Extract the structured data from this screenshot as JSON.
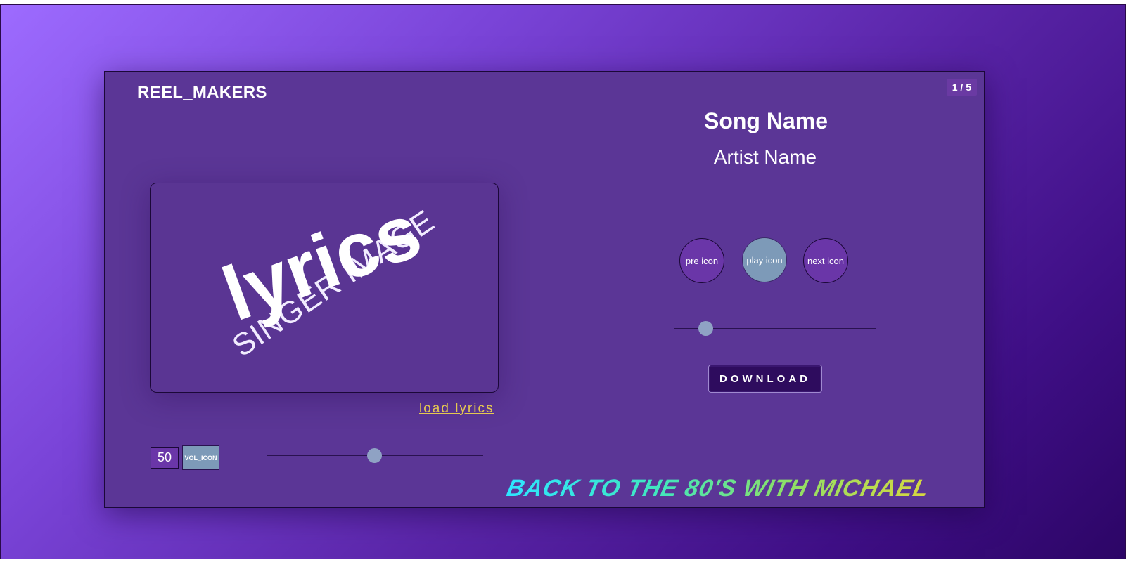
{
  "brand": "REEL_MAKERS",
  "counter": "1 / 5",
  "song": {
    "name": "Song Name",
    "artist": "Artist Name"
  },
  "art": {
    "singer_image_text": "SINGER IMAGE",
    "lyrics_text": "lyrics"
  },
  "load_lyrics_label": "load lyrics",
  "controls": {
    "pre_label": "pre icon",
    "play_label": "play icon",
    "next_label": "next icon"
  },
  "progress_fraction": 0.16,
  "download_label": "DOWNLOAD",
  "volume": {
    "value": "50",
    "icon_label": "VOL_ICON",
    "slider_fraction": 0.5
  },
  "banner_text": "BACK TO THE 80'S WITH MICHAEL",
  "colors": {
    "panel": "#5b3696",
    "accent_thumb": "#8fa2c4",
    "link": "#e5c850",
    "download_bg": "#2e0c5e"
  }
}
